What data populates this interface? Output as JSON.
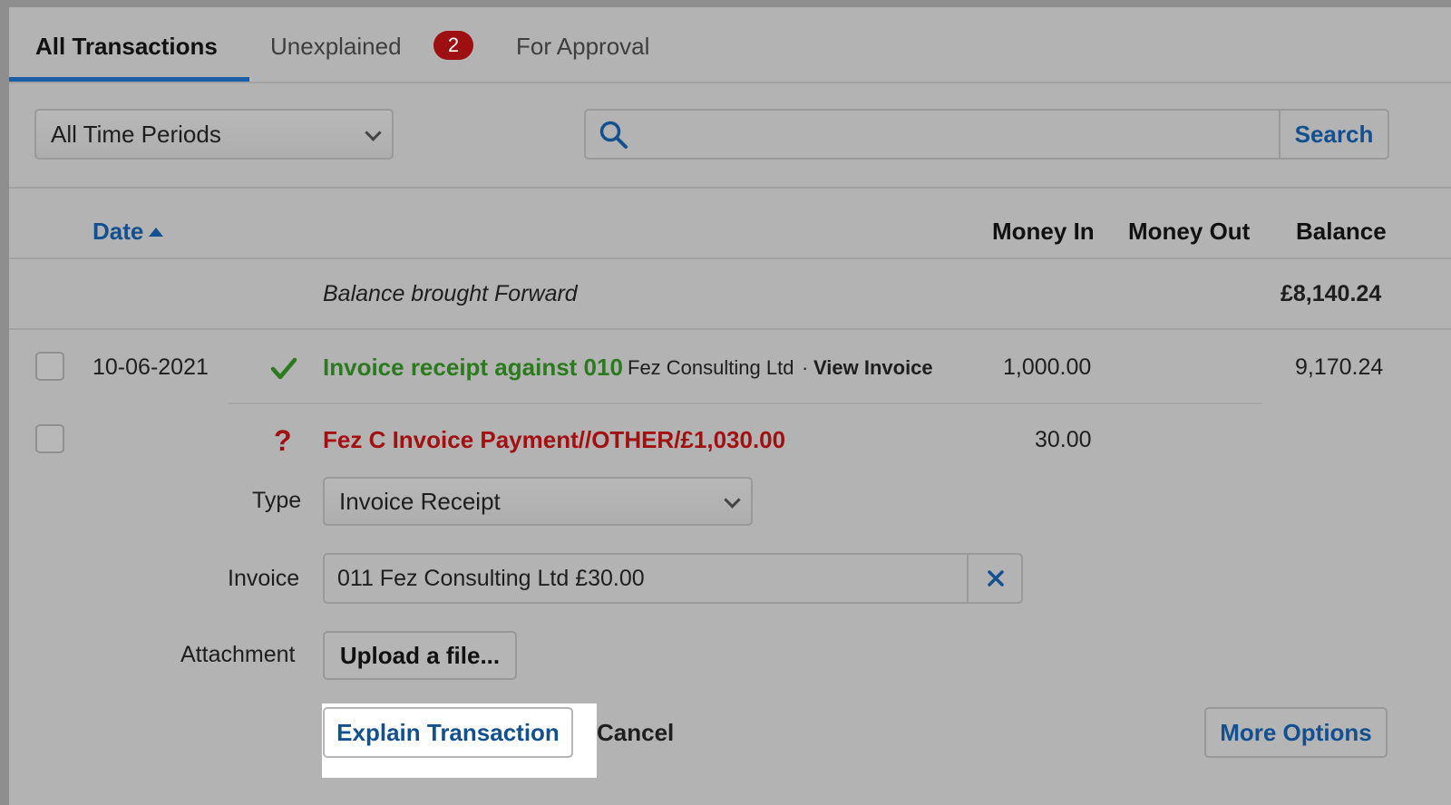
{
  "tabs": [
    {
      "label": "All Transactions",
      "active": true
    },
    {
      "label": "Unexplained",
      "badge": "2"
    },
    {
      "label": "For Approval"
    }
  ],
  "filters": {
    "period_select": "All Time Periods",
    "search_placeholder": "",
    "search_label": "Search"
  },
  "table": {
    "columns": {
      "date": "Date",
      "money_in": "Money In",
      "money_out": "Money Out",
      "balance": "Balance"
    },
    "balance_forward": {
      "label": "Balance brought Forward",
      "amount": "£8,140.24"
    },
    "rows": [
      {
        "date": "10-06-2021",
        "status": "explained",
        "title": "Invoice receipt against 010",
        "contact": "Fez Consulting Ltd",
        "separator": "·",
        "link": "View Invoice",
        "money_in": "1,000.00",
        "balance": "9,170.24"
      },
      {
        "status": "unexplained",
        "status_glyph": "?",
        "title": "Fez C Invoice Payment//OTHER/£1,030.00",
        "money_in": "30.00"
      }
    ]
  },
  "explain_form": {
    "type_label": "Type",
    "type_value": "Invoice Receipt",
    "invoice_label": "Invoice",
    "invoice_value": "011 Fez Consulting Ltd £30.00",
    "attachment_label": "Attachment",
    "upload_label": "Upload a file...",
    "explain_button": "Explain Transaction",
    "cancel_link": "Cancel",
    "more_options": "More Options"
  },
  "colors": {
    "accent_blue": "#13508f",
    "success_green": "#2b7a1e",
    "error_red": "#a31012"
  }
}
